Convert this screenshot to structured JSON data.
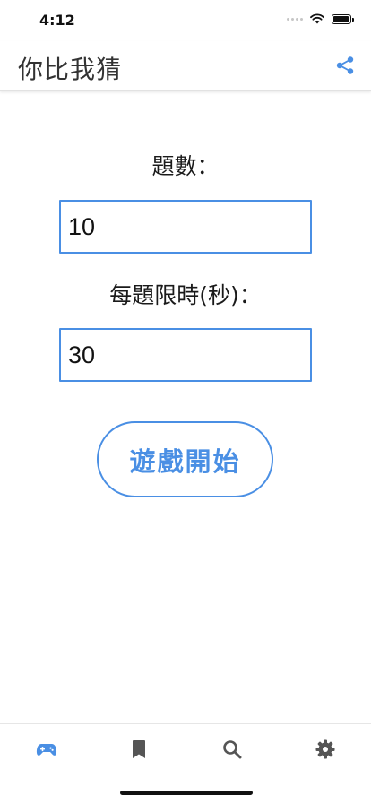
{
  "status_bar": {
    "time": "4:12"
  },
  "header": {
    "title": "你比我猜"
  },
  "form": {
    "question_count_label": "題數：",
    "question_count_value": "10",
    "time_limit_label": "每題限時(秒)：",
    "time_limit_value": "30",
    "start_button_label": "遊戲開始"
  },
  "tab_bar": {
    "active_index": 0,
    "tabs": [
      {
        "icon": "gamepad-icon"
      },
      {
        "icon": "bookmark-icon"
      },
      {
        "icon": "search-icon"
      },
      {
        "icon": "gear-icon"
      }
    ]
  },
  "colors": {
    "accent": "#4a8fe4",
    "inactive_icon": "#555555"
  }
}
